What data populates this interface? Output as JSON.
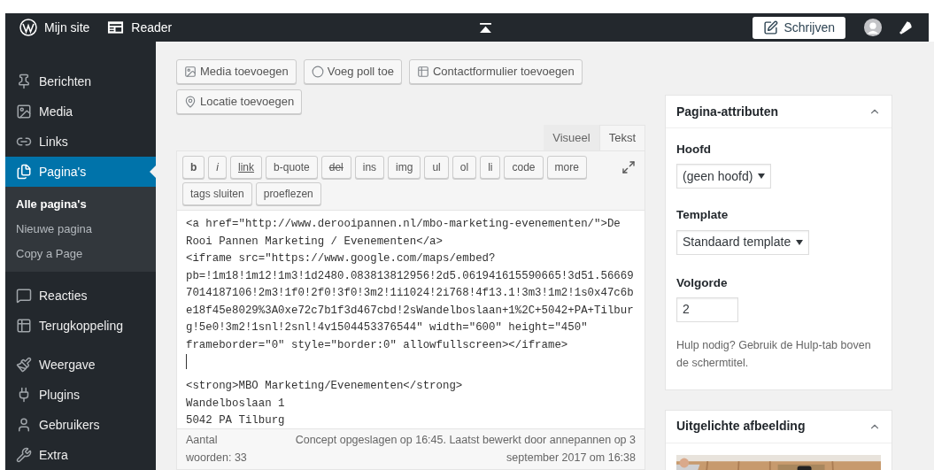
{
  "admin_bar": {
    "site": "Mijn site",
    "reader": "Reader",
    "write_button": "Schrijven"
  },
  "sidebar": {
    "items": [
      {
        "label": "Berichten",
        "selected": false
      },
      {
        "label": "Media",
        "selected": false
      },
      {
        "label": "Links",
        "selected": false
      },
      {
        "label": "Pagina's",
        "selected": true,
        "children": [
          {
            "label": "Alle pagina's",
            "selected": true
          },
          {
            "label": "Nieuwe pagina",
            "selected": false
          },
          {
            "label": "Copy a Page",
            "selected": false
          }
        ]
      },
      {
        "label": "Reacties",
        "selected": false
      },
      {
        "label": "Terugkoppeling",
        "selected": false
      },
      {
        "label": "Weergave",
        "selected": false
      },
      {
        "label": "Plugins",
        "selected": false
      },
      {
        "label": "Gebruikers",
        "selected": false
      },
      {
        "label": "Extra",
        "selected": false
      }
    ]
  },
  "media_buttons": [
    "Media toevoegen",
    "Voeg poll toe",
    "Contactformulier toevoegen",
    "Locatie toevoegen"
  ],
  "editor_tabs": [
    {
      "label": "Visueel",
      "selected": false
    },
    {
      "label": "Tekst",
      "selected": true
    }
  ],
  "quicktags": [
    "b",
    "i",
    "link",
    "b-quote",
    "del",
    "ins",
    "img",
    "ul",
    "ol",
    "li",
    "code",
    "more",
    "tags sluiten",
    "proeflezen"
  ],
  "code_lines": [
    "<a href=\"http://www.derooipannen.nl/mbo-marketing-evenementen/\">De",
    "Rooi Pannen Marketing / Evenementen</a>",
    "<iframe src=\"https://www.google.com/maps/embed?",
    "pb=!1m18!1m12!1m3!1d2480.083813812956!2d5.061941615590665!3d51.56669",
    "7014187106!2m3!1f0!2f0!3f0!3m2!1i1024!2i768!4f13.1!3m3!1m2!1s0x47c6b",
    "e18f45e8029%3A0xe72c7b1f3d467cbd!2sWandelboslaan+1%2C+5042+PA+Tilbur",
    "g!5e0!3m2!1snl!2snl!4v1504453376544\" width=\"600\" height=\"450\"",
    "frameborder=\"0\" style=\"border:0\" allowfullscreen></iframe>"
  ],
  "code_lines_after_cursor": [
    "<strong>MBO Marketing/Evenementen</strong>",
    "Wandelboslaan 1",
    "5042 PA Tilburg"
  ],
  "status_bar": {
    "word_count": "Aantal woorden: 33",
    "saved": "Concept opgeslagen op 16:45. Laatst bewerkt door annepannen op 3 september 2017 om 16:38"
  },
  "page_attributes": {
    "title": "Pagina-attributen",
    "parent_label": "Hoofd",
    "parent_value": "(geen hoofd)",
    "template_label": "Template",
    "template_value": "Standaard template",
    "order_label": "Volgorde",
    "order_value": "2",
    "help": "Hulp nodig? Gebruik de Hulp-tab boven de schermtitel."
  },
  "featured_image": {
    "title": "Uitgelichte afbeelding",
    "kind": "picture"
  }
}
